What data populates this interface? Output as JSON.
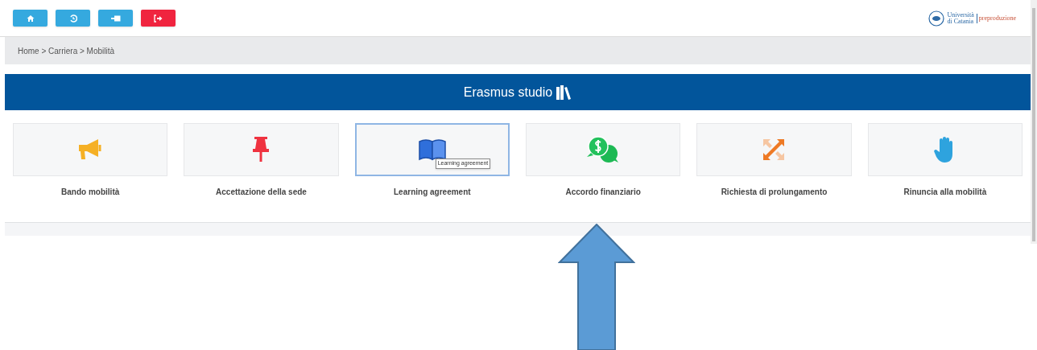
{
  "toolbar": [
    {
      "kind": "home"
    },
    {
      "kind": "history"
    },
    {
      "kind": "card"
    },
    {
      "kind": "logout"
    }
  ],
  "logo": {
    "name_line1": "Università",
    "name_line2": "di Catania",
    "environment": "preproduzione"
  },
  "breadcrumb": "Home > Carriera > Mobilità",
  "section": {
    "title": "Erasmus studio"
  },
  "tiles": [
    {
      "kind": "megaphone",
      "label": "Bando mobilità",
      "selected": false
    },
    {
      "kind": "pin",
      "label": "Accettazione della sede",
      "selected": false
    },
    {
      "kind": "book",
      "label": "Learning agreement",
      "selected": true,
      "tooltip": "Learning agreement"
    },
    {
      "kind": "money",
      "label": "Accordo finanziario",
      "selected": false
    },
    {
      "kind": "expand",
      "label": "Richiesta di prolungamento",
      "selected": false
    },
    {
      "kind": "hand",
      "label": "Rinuncia alla mobilità",
      "selected": false
    }
  ],
  "annotation": {
    "kind": "arrow"
  }
}
